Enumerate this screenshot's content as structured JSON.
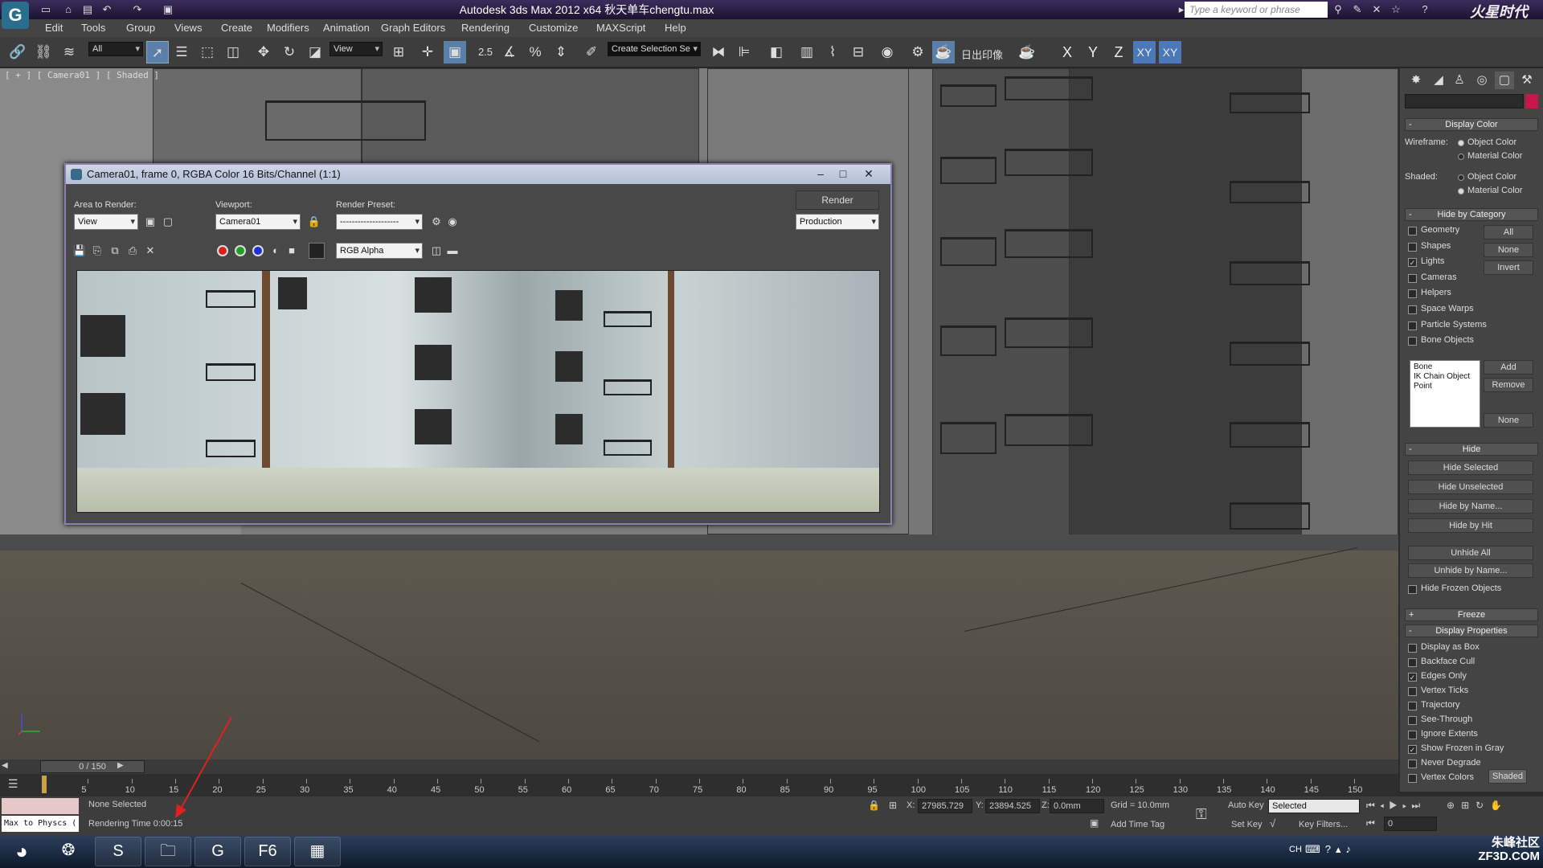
{
  "titlebar": {
    "title": "Autodesk 3ds Max  2012 x64      秋天单车chengtu.max",
    "search_placeholder": "Type a keyword or phrase",
    "brand": "火星时代",
    "app_logo_icon": "3dsmax-logo"
  },
  "menubar": {
    "items": [
      "Edit",
      "Tools",
      "Group",
      "Views",
      "Create",
      "Modifiers",
      "Animation",
      "Graph Editors",
      "Rendering",
      "Customize",
      "MAXScript",
      "Help"
    ]
  },
  "toolbar": {
    "selection_filter": "All",
    "ref_coord": "View",
    "snap_value": "2.5",
    "named_selection": "Create Selection Se",
    "render_text": "日出印像",
    "axes": [
      "X",
      "Y",
      "Z",
      "XY",
      "XY"
    ]
  },
  "viewport": {
    "label": "[ + ] [ Camera01 ] [ Shaded ]"
  },
  "render_frame": {
    "title": "Camera01, frame 0, RGBA Color 16 Bits/Channel (1:1)",
    "area_label": "Area to Render:",
    "area_value": "View",
    "viewport_label": "Viewport:",
    "viewport_value": "Camera01",
    "preset_label": "Render Preset:",
    "preset_value": "--------------------",
    "render_button": "Render",
    "production_value": "Production",
    "channel_value": "RGB Alpha"
  },
  "command_panel": {
    "display_color": {
      "title": "Display Color",
      "wireframe_label": "Wireframe:",
      "shaded_label": "Shaded:",
      "object_color": "Object Color",
      "material_color": "Material Color"
    },
    "hide_by_category": {
      "title": "Hide by Category",
      "items": [
        {
          "label": "Geometry",
          "checked": false
        },
        {
          "label": "Shapes",
          "checked": false
        },
        {
          "label": "Lights",
          "checked": true
        },
        {
          "label": "Cameras",
          "checked": false
        },
        {
          "label": "Helpers",
          "checked": false
        },
        {
          "label": "Space Warps",
          "checked": false
        },
        {
          "label": "Particle Systems",
          "checked": false
        },
        {
          "label": "Bone Objects",
          "checked": false
        }
      ],
      "btn_all": "All",
      "btn_none": "None",
      "btn_invert": "Invert",
      "list_items": [
        "Bone",
        "IK Chain Object",
        "Point"
      ],
      "btn_add": "Add",
      "btn_remove": "Remove",
      "btn_none2": "None"
    },
    "hide": {
      "title": "Hide",
      "buttons": [
        "Hide Selected",
        "Hide Unselected",
        "Hide by Name...",
        "Hide by Hit",
        "Unhide All",
        "Unhide by Name..."
      ],
      "hide_frozen": "Hide Frozen Objects"
    },
    "freeze": {
      "title": "Freeze"
    },
    "display_properties": {
      "title": "Display Properties",
      "items": [
        {
          "label": "Display as Box",
          "checked": false
        },
        {
          "label": "Backface Cull",
          "checked": false
        },
        {
          "label": "Edges Only",
          "checked": true
        },
        {
          "label": "Vertex Ticks",
          "checked": false
        },
        {
          "label": "Trajectory",
          "checked": false
        },
        {
          "label": "See-Through",
          "checked": false
        },
        {
          "label": "Ignore Extents",
          "checked": false
        },
        {
          "label": "Show Frozen in Gray",
          "checked": true
        },
        {
          "label": "Never Degrade",
          "checked": false
        },
        {
          "label": "Vertex Colors",
          "checked": false
        }
      ],
      "shaded_btn": "Shaded"
    }
  },
  "timeline": {
    "slider": "0 / 150",
    "ticks": [
      "5",
      "10",
      "15",
      "20",
      "25",
      "30",
      "35",
      "40",
      "45",
      "50",
      "55",
      "60",
      "65",
      "70",
      "75",
      "80",
      "85",
      "90",
      "95",
      "100",
      "105",
      "110",
      "115",
      "120",
      "125",
      "130",
      "135",
      "140",
      "145",
      "150"
    ]
  },
  "status": {
    "script_listener": "Max to Physcs (",
    "selection": "None Selected",
    "prompt": "Rendering Time  0:00:15",
    "x_label": "X:",
    "x_value": "27985.729",
    "y_label": "Y:",
    "y_value": "23894.525",
    "z_label": "Z:",
    "z_value": "0.0mm",
    "grid": "Grid = 10.0mm",
    "add_time_tag": "Add Time Tag",
    "auto_key": "Auto Key",
    "set_key": "Set Key",
    "key_mode": "Selected",
    "key_filters": "Key Filters...",
    "frame": "0"
  },
  "taskbar": {
    "tray_lang": "CH",
    "watermark": "朱峰社区\nZF3D.COM"
  }
}
